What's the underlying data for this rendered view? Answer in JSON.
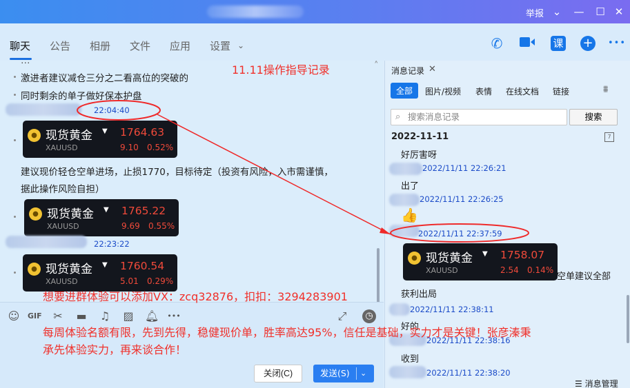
{
  "titlebar": {
    "report": "举报",
    "controls": [
      "chevron-down",
      "minimize",
      "maximize",
      "close"
    ]
  },
  "tabs": [
    {
      "label": "聊天",
      "active": true
    },
    {
      "label": "公告"
    },
    {
      "label": "相册"
    },
    {
      "label": "文件"
    },
    {
      "label": "应用"
    },
    {
      "label": "设置"
    }
  ],
  "toolbar_icons": {
    "class_label": "课",
    "add_label": "+",
    "more_label": "•••"
  },
  "chat": {
    "lines": [
      "激进者建议减仓三分之二看高位的突破的",
      "同时剩余的单子做好保本护盘"
    ],
    "annotation_title": "11.11操作指导记录",
    "msg1_time": "22:04:40",
    "msg2_text_1": "建议现价轻仓空单进场，止损1770，目标待定（投资有风险，入市需谨慎，",
    "msg2_text_2": "据此操作风险自担）",
    "msg3_time": "22:23:22",
    "cards": [
      {
        "name": "现货黄金",
        "symbol": "XAUUSD",
        "price": "1764.63",
        "change": "9.10",
        "pct": "0.52%"
      },
      {
        "name": "现货黄金",
        "symbol": "XAUUSD",
        "price": "1765.22",
        "change": "9.69",
        "pct": "0.55%"
      },
      {
        "name": "现货黄金",
        "symbol": "XAUUSD",
        "price": "1760.54",
        "change": "5.01",
        "pct": "0.29%"
      }
    ]
  },
  "banner": {
    "line1": "想要进群体验可以添加VX：zcq32876，扣扣：3294283901",
    "line2": "每周体验名额有限，先到先得，稳健现价单，胜率高达95%，信任是基础，实力才是关键！张彦溱秉",
    "line3": "承先体验实力，再来谈合作！"
  },
  "input": {
    "tools": [
      "emoji-icon",
      "gif-icon",
      "scissors-icon",
      "folder-icon",
      "music-icon",
      "image-icon",
      "bell-icon",
      "more-icon"
    ],
    "gif_label": "GIF",
    "more_label": "•••",
    "close_label": "关闭(C)",
    "send_label": "发送(S)"
  },
  "history": {
    "title": "消息记录",
    "filters": [
      "全部",
      "图片/视频",
      "表情",
      "在线文档",
      "链接"
    ],
    "search_placeholder": "搜索消息记录",
    "search_button": "搜索",
    "date": "2022-11-11",
    "calendar_label": "7",
    "messages": [
      {
        "text": "好厉害呀",
        "time": "2022/11/11 22:26:21"
      },
      {
        "text": "出了",
        "time": "2022/11/11 22:26:25"
      },
      {
        "text": "👍",
        "time": "2022/11/11 22:37:59"
      },
      {
        "text": "空单建议全部",
        "time": ""
      },
      {
        "text": "获利出局",
        "time": "2022/11/11 22:38:11"
      },
      {
        "text": "好的",
        "time": "2022/11/11 22:38:16"
      },
      {
        "text": "收到",
        "time": "2022/11/11 22:38:20"
      }
    ],
    "card": {
      "name": "现货黄金",
      "symbol": "XAUUSD",
      "price": "1758.07",
      "change": "2.54",
      "pct": "0.14%"
    },
    "manage_label": "消息管理"
  }
}
